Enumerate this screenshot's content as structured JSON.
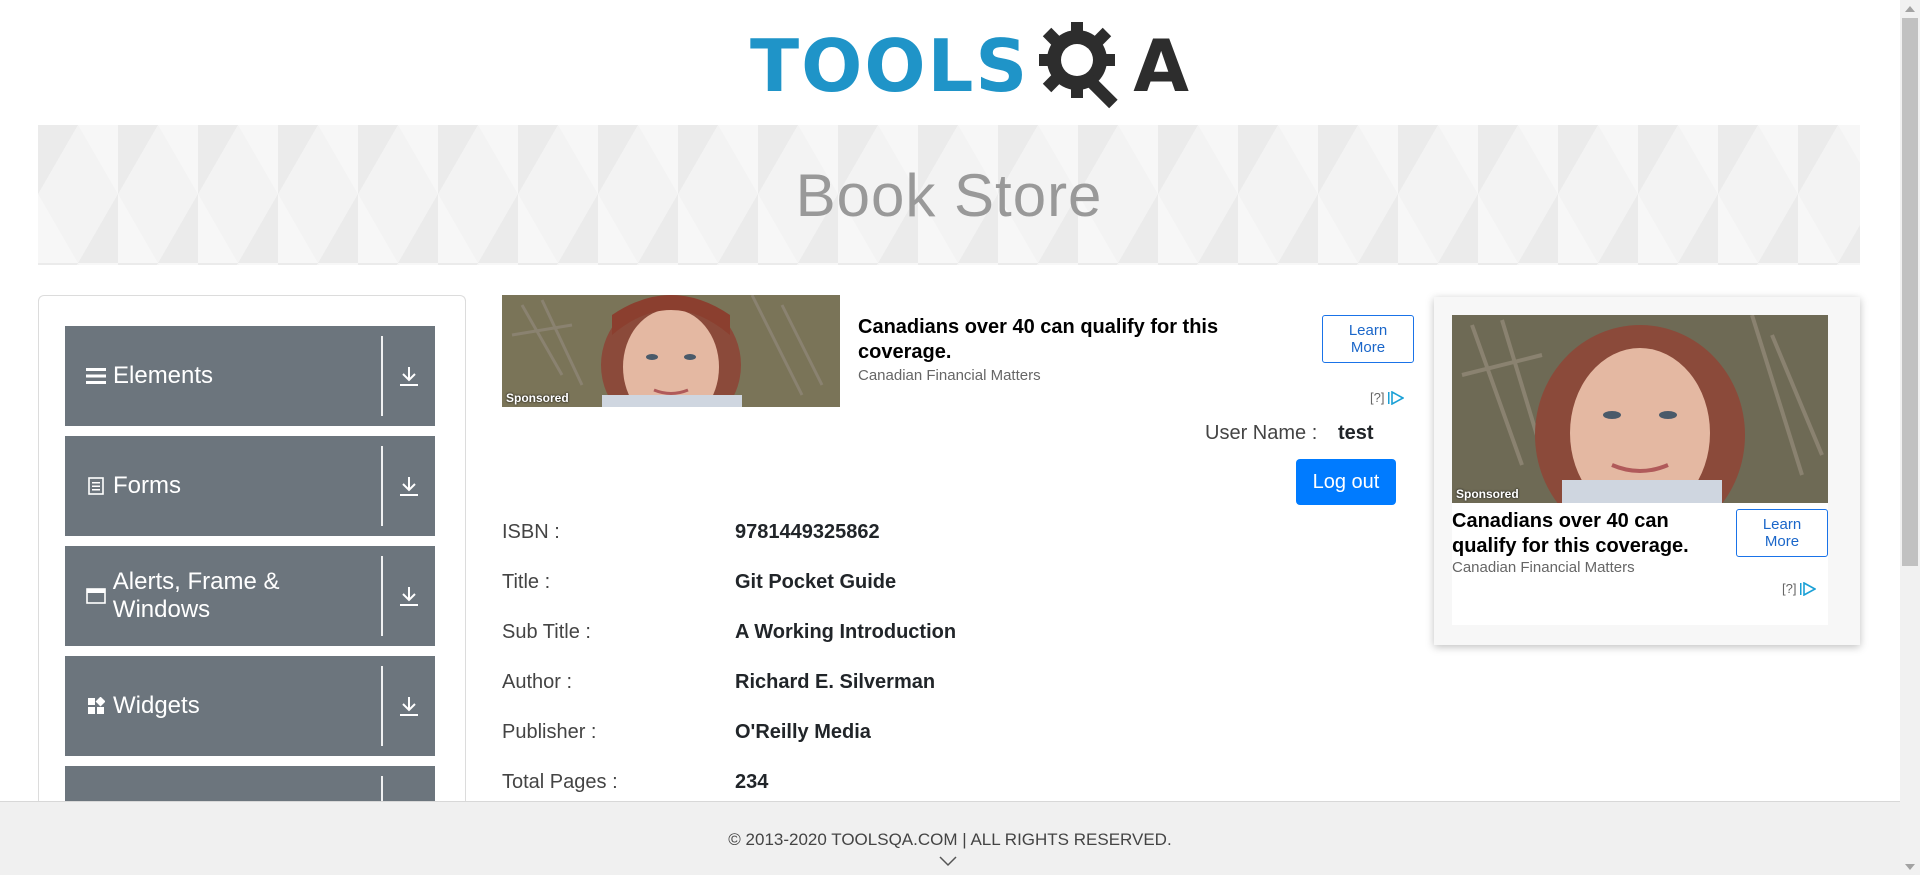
{
  "header": {
    "logo_text_left": "TOOLS",
    "logo_text_right": "A",
    "brand_blue": "#1f94c8",
    "brand_dark": "#2d2d2d"
  },
  "banner": {
    "title": "Book Store"
  },
  "sidebar": {
    "groups": [
      {
        "label": "Elements",
        "icon": "hamburger-icon"
      },
      {
        "label": "Forms",
        "icon": "document-icon"
      },
      {
        "label": "Alerts, Frame & Windows",
        "icon": "window-icon"
      },
      {
        "label": "Widgets",
        "icon": "widgets-icon"
      },
      {
        "label": "",
        "icon": ""
      }
    ],
    "group_bg": "#6c757d"
  },
  "ad_top": {
    "headline": "Canadians over 40 can qualify for this coverage.",
    "source": "Canadian Financial Matters",
    "cta": "Learn More",
    "sponsored": "Sponsored",
    "choices": "[?]"
  },
  "user": {
    "label": "User Name :",
    "value": "test",
    "logout": "Log out",
    "accent": "#007bff"
  },
  "book": {
    "rows": [
      {
        "label": "ISBN :",
        "value": "9781449325862"
      },
      {
        "label": "Title :",
        "value": "Git Pocket Guide"
      },
      {
        "label": "Sub Title :",
        "value": "A Working Introduction"
      },
      {
        "label": "Author :",
        "value": "Richard E. Silverman"
      },
      {
        "label": "Publisher :",
        "value": "O'Reilly Media"
      },
      {
        "label": "Total Pages :",
        "value": "234"
      }
    ]
  },
  "ad_right": {
    "headline": "Canadians over 40 can qualify for this coverage.",
    "source": "Canadian Financial Matters",
    "cta": "Learn More",
    "sponsored": "Sponsored",
    "choices": "[?]"
  },
  "footer": {
    "text": "© 2013-2020 TOOLSQA.COM | ALL RIGHTS RESERVED."
  }
}
